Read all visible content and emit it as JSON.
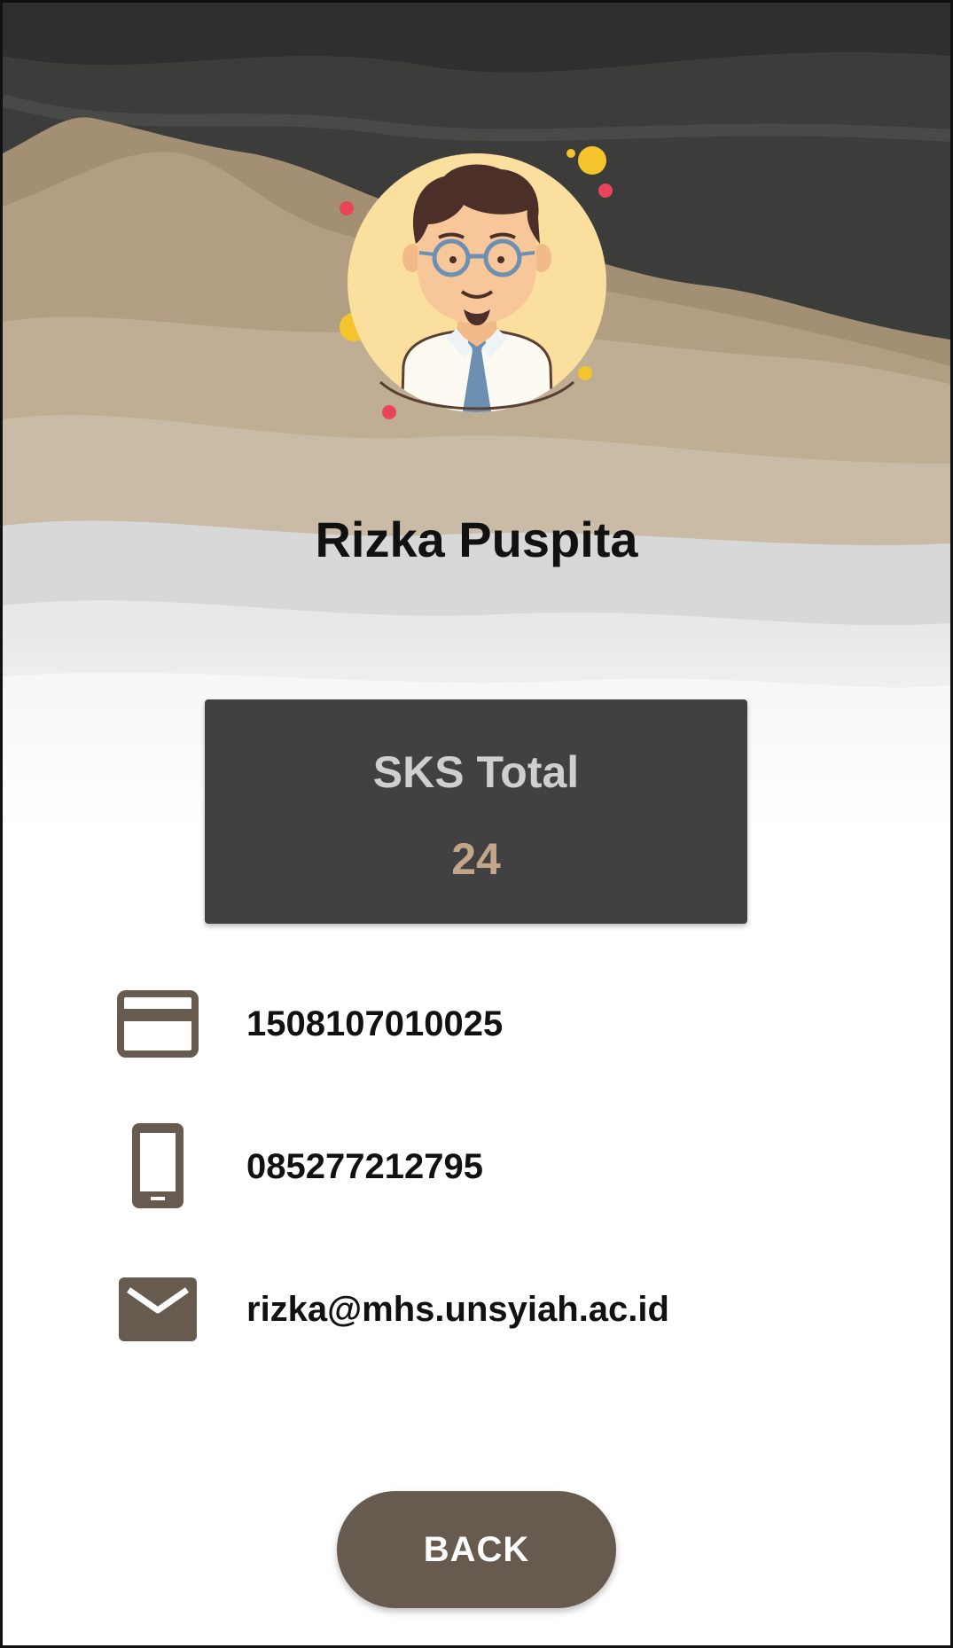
{
  "profile": {
    "name": "Rizka Puspita"
  },
  "sks": {
    "label": "SKS Total",
    "value": "24"
  },
  "info": {
    "student_id": "1508107010025",
    "phone": "085277212795",
    "email": "rizka@mhs.unsyiah.ac.id"
  },
  "actions": {
    "back_label": "BACK"
  },
  "colors": {
    "accent_brown": "#675a4e",
    "card_dark": "#414141",
    "sks_value": "#c2a689",
    "avatar_bg": "#fadf9e"
  },
  "icons": {
    "student_id": "credit-card-icon",
    "phone": "smartphone-icon",
    "email": "envelope-icon"
  }
}
